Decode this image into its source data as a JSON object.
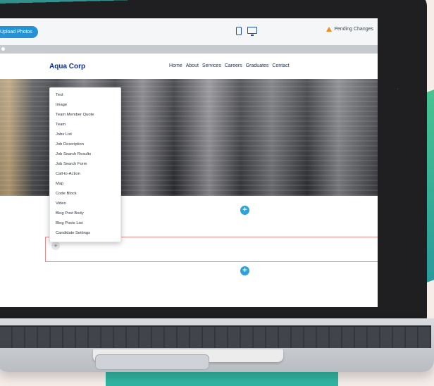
{
  "toolbar": {
    "upload_label": "Upload Photos",
    "pending_label": "Pending Changes"
  },
  "site": {
    "brand": "Aqua Corp",
    "menu": [
      "Home",
      "About",
      "Services",
      "Careers",
      "Graduates",
      "Contact"
    ]
  },
  "dropdown": {
    "items": [
      "Text",
      "Image",
      "Team Member Quote",
      "Team",
      "Jobs List",
      "Job Description",
      "Job Search Results",
      "Job Search Form",
      "Call-to-Action",
      "Map",
      "Code Block",
      "Video",
      "Blog Post Body",
      "Blog Posts List",
      "Candidate Settings"
    ]
  },
  "buttons": {
    "add_symbol": "+"
  },
  "colors": {
    "brand_blue": "#0d2c8c",
    "accent_blue": "#2fa0d8",
    "warning": "#f28b22"
  }
}
